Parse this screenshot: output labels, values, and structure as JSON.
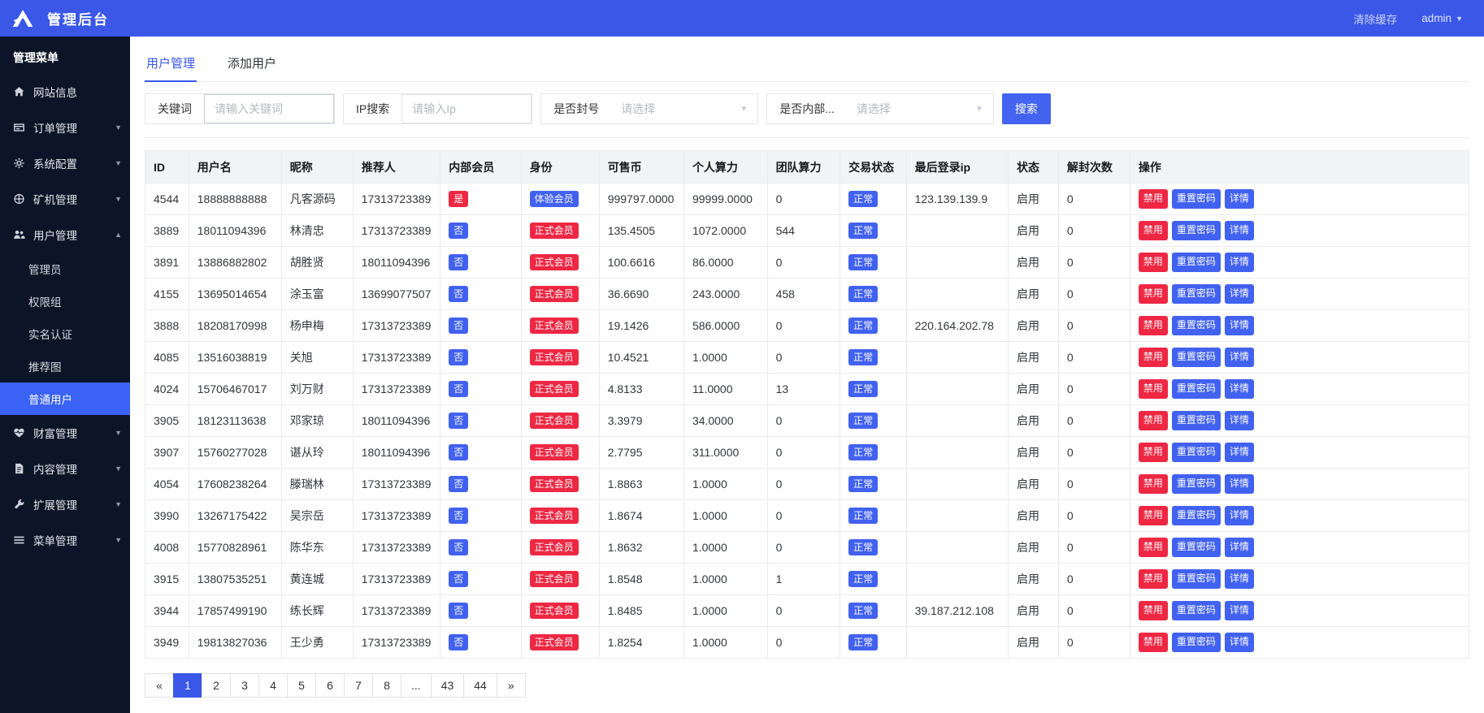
{
  "colors": {
    "primary_blue": "#3a57e8",
    "badge_blue": "#4161f0",
    "badge_red": "#ee2743",
    "sidebar_bg": "#0c1527",
    "sidebar_active": "#3a62f4",
    "table_header_bg": "#f2f3f5"
  },
  "topbar": {
    "title": "管理后台",
    "clear_cache": "清除缓存",
    "username": "admin"
  },
  "sidebar": {
    "header": "管理菜单",
    "items": [
      {
        "key": "website-info",
        "label": "网站信息",
        "icon": "home-icon",
        "arrow": null
      },
      {
        "key": "order-mgmt",
        "label": "订单管理",
        "icon": "order-icon",
        "arrow": "down"
      },
      {
        "key": "system-config",
        "label": "系统配置",
        "icon": "gear-icon",
        "arrow": "down"
      },
      {
        "key": "miner-mgmt",
        "label": "矿机管理",
        "icon": "miner-icon",
        "arrow": "down"
      },
      {
        "key": "user-mgmt",
        "label": "用户管理",
        "icon": "users-icon",
        "arrow": "up",
        "expanded": true,
        "children": [
          {
            "key": "admins",
            "label": "管理员"
          },
          {
            "key": "permission-groups",
            "label": "权限组"
          },
          {
            "key": "realname-auth",
            "label": "实名认证"
          },
          {
            "key": "referral-image",
            "label": "推荐图"
          },
          {
            "key": "normal-users",
            "label": "普通用户",
            "active": true
          }
        ]
      },
      {
        "key": "wealth-mgmt",
        "label": "财富管理",
        "icon": "wealth-icon",
        "arrow": "down"
      },
      {
        "key": "content-mgmt",
        "label": "内容管理",
        "icon": "content-icon",
        "arrow": "down"
      },
      {
        "key": "extension-mgmt",
        "label": "扩展管理",
        "icon": "wrench-icon",
        "arrow": "down"
      },
      {
        "key": "menu-mgmt",
        "label": "菜单管理",
        "icon": "menu-icon",
        "arrow": "down"
      }
    ]
  },
  "tabs": [
    {
      "label": "用户管理",
      "active": true
    },
    {
      "label": "添加用户",
      "active": false
    }
  ],
  "filters": {
    "keyword_label": "关键词",
    "keyword_placeholder": "请输入关键词",
    "ip_label": "IP搜索",
    "ip_placeholder": "请输入Ip",
    "banned_label": "是否封号",
    "banned_placeholder": "请选择",
    "internal_label": "是否内部...",
    "internal_placeholder": "请选择",
    "search_button": "搜索"
  },
  "table": {
    "columns": [
      "ID",
      "用户名",
      "昵称",
      "推荐人",
      "内部会员",
      "身份",
      "可售币",
      "个人算力",
      "团队算力",
      "交易状态",
      "最后登录ip",
      "状态",
      "解封次数",
      "操作"
    ],
    "action_buttons": [
      {
        "label": "禁用",
        "color": "red",
        "name": "disable-button"
      },
      {
        "label": "重置密码",
        "color": "blue",
        "name": "reset-password-button"
      },
      {
        "label": "详情",
        "color": "blue",
        "name": "details-button"
      }
    ],
    "rows": [
      {
        "id": "4544",
        "username": "18888888888",
        "nickname": "凡客源码",
        "referrer": "17313723389",
        "internal": {
          "text": "是",
          "color": "red"
        },
        "identity": {
          "text": "体验会员",
          "color": "blue"
        },
        "coins": "999797.0000",
        "personal_power": "99999.0000",
        "team_power": "0",
        "trade_status": {
          "text": "正常",
          "color": "blue"
        },
        "last_login_ip": "123.139.139.9",
        "status": "启用",
        "unban_count": "0"
      },
      {
        "id": "3889",
        "username": "18011094396",
        "nickname": "林清忠",
        "referrer": "17313723389",
        "internal": {
          "text": "否",
          "color": "blue"
        },
        "identity": {
          "text": "正式会员",
          "color": "red"
        },
        "coins": "135.4505",
        "personal_power": "1072.0000",
        "team_power": "544",
        "trade_status": {
          "text": "正常",
          "color": "blue"
        },
        "last_login_ip": "",
        "status": "启用",
        "unban_count": "0"
      },
      {
        "id": "3891",
        "username": "13886882802",
        "nickname": "胡胜贤",
        "referrer": "18011094396",
        "internal": {
          "text": "否",
          "color": "blue"
        },
        "identity": {
          "text": "正式会员",
          "color": "red"
        },
        "coins": "100.6616",
        "personal_power": "86.0000",
        "team_power": "0",
        "trade_status": {
          "text": "正常",
          "color": "blue"
        },
        "last_login_ip": "",
        "status": "启用",
        "unban_count": "0"
      },
      {
        "id": "4155",
        "username": "13695014654",
        "nickname": "涂玉富",
        "referrer": "13699077507",
        "internal": {
          "text": "否",
          "color": "blue"
        },
        "identity": {
          "text": "正式会员",
          "color": "red"
        },
        "coins": "36.6690",
        "personal_power": "243.0000",
        "team_power": "458",
        "trade_status": {
          "text": "正常",
          "color": "blue"
        },
        "last_login_ip": "",
        "status": "启用",
        "unban_count": "0"
      },
      {
        "id": "3888",
        "username": "18208170998",
        "nickname": "杨申梅",
        "referrer": "17313723389",
        "internal": {
          "text": "否",
          "color": "blue"
        },
        "identity": {
          "text": "正式会员",
          "color": "red"
        },
        "coins": "19.1426",
        "personal_power": "586.0000",
        "team_power": "0",
        "trade_status": {
          "text": "正常",
          "color": "blue"
        },
        "last_login_ip": "220.164.202.78",
        "status": "启用",
        "unban_count": "0"
      },
      {
        "id": "4085",
        "username": "13516038819",
        "nickname": "关旭",
        "referrer": "17313723389",
        "internal": {
          "text": "否",
          "color": "blue"
        },
        "identity": {
          "text": "正式会员",
          "color": "red"
        },
        "coins": "10.4521",
        "personal_power": "1.0000",
        "team_power": "0",
        "trade_status": {
          "text": "正常",
          "color": "blue"
        },
        "last_login_ip": "",
        "status": "启用",
        "unban_count": "0"
      },
      {
        "id": "4024",
        "username": "15706467017",
        "nickname": "刘万财",
        "referrer": "17313723389",
        "internal": {
          "text": "否",
          "color": "blue"
        },
        "identity": {
          "text": "正式会员",
          "color": "red"
        },
        "coins": "4.8133",
        "personal_power": "11.0000",
        "team_power": "13",
        "trade_status": {
          "text": "正常",
          "color": "blue"
        },
        "last_login_ip": "",
        "status": "启用",
        "unban_count": "0"
      },
      {
        "id": "3905",
        "username": "18123113638",
        "nickname": "邓家琼",
        "referrer": "18011094396",
        "internal": {
          "text": "否",
          "color": "blue"
        },
        "identity": {
          "text": "正式会员",
          "color": "red"
        },
        "coins": "3.3979",
        "personal_power": "34.0000",
        "team_power": "0",
        "trade_status": {
          "text": "正常",
          "color": "blue"
        },
        "last_login_ip": "",
        "status": "启用",
        "unban_count": "0"
      },
      {
        "id": "3907",
        "username": "15760277028",
        "nickname": "谌从玲",
        "referrer": "18011094396",
        "internal": {
          "text": "否",
          "color": "blue"
        },
        "identity": {
          "text": "正式会员",
          "color": "red"
        },
        "coins": "2.7795",
        "personal_power": "311.0000",
        "team_power": "0",
        "trade_status": {
          "text": "正常",
          "color": "blue"
        },
        "last_login_ip": "",
        "status": "启用",
        "unban_count": "0"
      },
      {
        "id": "4054",
        "username": "17608238264",
        "nickname": "滕瑞林",
        "referrer": "17313723389",
        "internal": {
          "text": "否",
          "color": "blue"
        },
        "identity": {
          "text": "正式会员",
          "color": "red"
        },
        "coins": "1.8863",
        "personal_power": "1.0000",
        "team_power": "0",
        "trade_status": {
          "text": "正常",
          "color": "blue"
        },
        "last_login_ip": "",
        "status": "启用",
        "unban_count": "0"
      },
      {
        "id": "3990",
        "username": "13267175422",
        "nickname": "吴宗岳",
        "referrer": "17313723389",
        "internal": {
          "text": "否",
          "color": "blue"
        },
        "identity": {
          "text": "正式会员",
          "color": "red"
        },
        "coins": "1.8674",
        "personal_power": "1.0000",
        "team_power": "0",
        "trade_status": {
          "text": "正常",
          "color": "blue"
        },
        "last_login_ip": "",
        "status": "启用",
        "unban_count": "0"
      },
      {
        "id": "4008",
        "username": "15770828961",
        "nickname": "陈华东",
        "referrer": "17313723389",
        "internal": {
          "text": "否",
          "color": "blue"
        },
        "identity": {
          "text": "正式会员",
          "color": "red"
        },
        "coins": "1.8632",
        "personal_power": "1.0000",
        "team_power": "0",
        "trade_status": {
          "text": "正常",
          "color": "blue"
        },
        "last_login_ip": "",
        "status": "启用",
        "unban_count": "0"
      },
      {
        "id": "3915",
        "username": "13807535251",
        "nickname": "黄连城",
        "referrer": "17313723389",
        "internal": {
          "text": "否",
          "color": "blue"
        },
        "identity": {
          "text": "正式会员",
          "color": "red"
        },
        "coins": "1.8548",
        "personal_power": "1.0000",
        "team_power": "1",
        "trade_status": {
          "text": "正常",
          "color": "blue"
        },
        "last_login_ip": "",
        "status": "启用",
        "unban_count": "0"
      },
      {
        "id": "3944",
        "username": "17857499190",
        "nickname": "练长辉",
        "referrer": "17313723389",
        "internal": {
          "text": "否",
          "color": "blue"
        },
        "identity": {
          "text": "正式会员",
          "color": "red"
        },
        "coins": "1.8485",
        "personal_power": "1.0000",
        "team_power": "0",
        "trade_status": {
          "text": "正常",
          "color": "blue"
        },
        "last_login_ip": "39.187.212.108",
        "status": "启用",
        "unban_count": "0"
      },
      {
        "id": "3949",
        "username": "19813827036",
        "nickname": "王少勇",
        "referrer": "17313723389",
        "internal": {
          "text": "否",
          "color": "blue"
        },
        "identity": {
          "text": "正式会员",
          "color": "red"
        },
        "coins": "1.8254",
        "personal_power": "1.0000",
        "team_power": "0",
        "trade_status": {
          "text": "正常",
          "color": "blue"
        },
        "last_login_ip": "",
        "status": "启用",
        "unban_count": "0"
      }
    ]
  },
  "pagination": {
    "items": [
      {
        "label": "«",
        "name": "prev-page-button"
      },
      {
        "label": "1",
        "name": "page-number-button",
        "active": true
      },
      {
        "label": "2",
        "name": "page-number-button"
      },
      {
        "label": "3",
        "name": "page-number-button"
      },
      {
        "label": "4",
        "name": "page-number-button"
      },
      {
        "label": "5",
        "name": "page-number-button"
      },
      {
        "label": "6",
        "name": "page-number-button"
      },
      {
        "label": "7",
        "name": "page-number-button"
      },
      {
        "label": "8",
        "name": "page-number-button"
      },
      {
        "label": "...",
        "name": "pagination-ellipsis",
        "static": true
      },
      {
        "label": "43",
        "name": "page-number-button"
      },
      {
        "label": "44",
        "name": "page-number-button"
      },
      {
        "label": "»",
        "name": "next-page-button"
      }
    ]
  }
}
